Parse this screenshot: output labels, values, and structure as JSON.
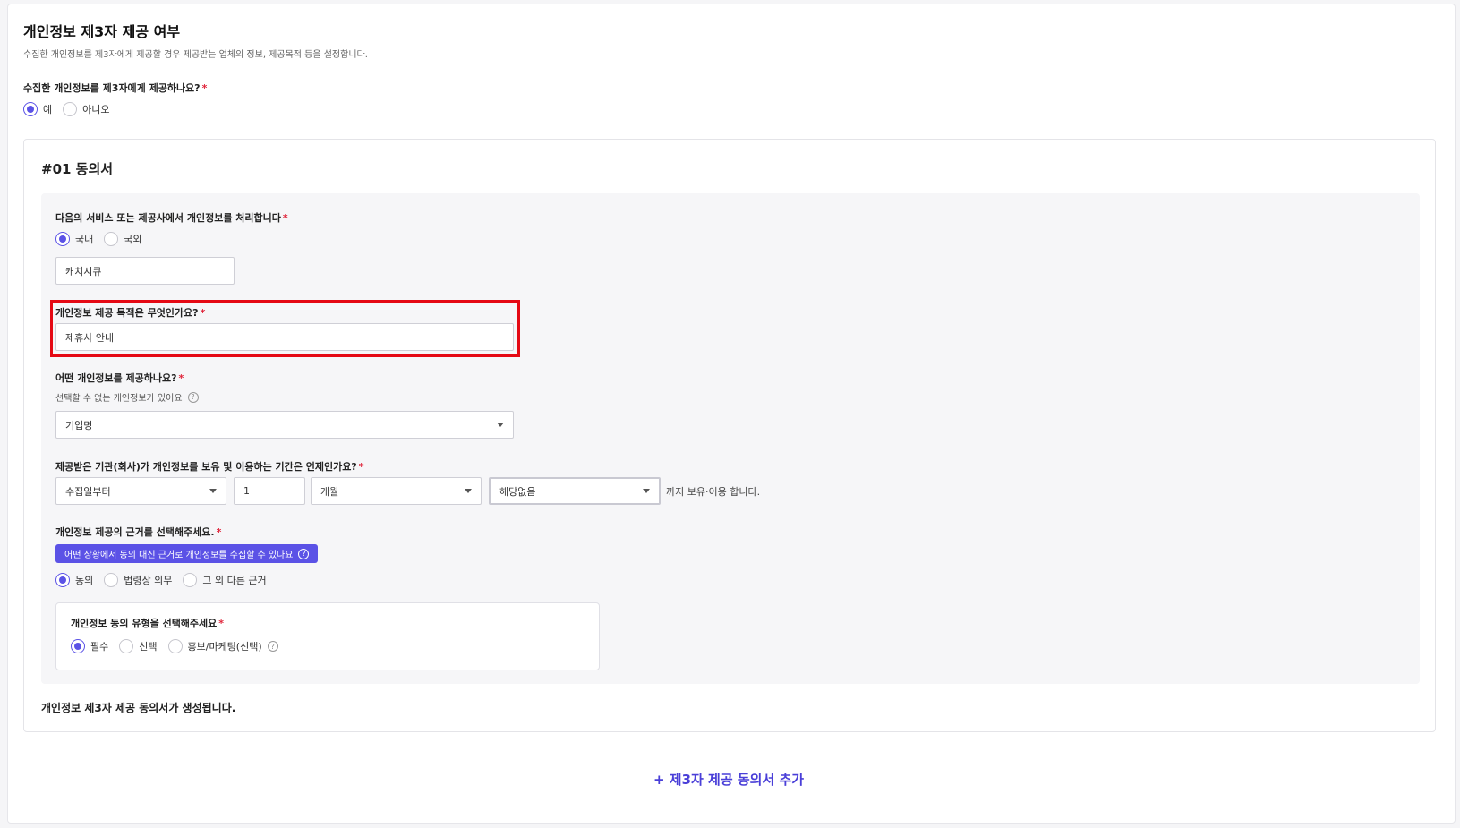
{
  "page": {
    "title": "개인정보 제3자 제공 여부",
    "description": "수집한 개인정보를 제3자에게 제공할 경우 제공받는 업체의 정보, 제공목적 등을 설정합니다."
  },
  "provide_question": {
    "label": "수집한 개인정보를 제3자에게 제공하나요?",
    "required_mark": "*",
    "options": [
      "예",
      "아니오"
    ],
    "selected": "예"
  },
  "consent": {
    "title": "#01 동의서",
    "processor": {
      "label": "다음의 서비스 또는 제공사에서 개인정보를 처리합니다",
      "required_mark": "*",
      "options": [
        "국내",
        "국외"
      ],
      "selected": "국내",
      "company_value": "캐치시큐"
    },
    "purpose": {
      "label": "개인정보 제공 목적은 무엇인가요?",
      "required_mark": "*",
      "value": "제휴사 안내"
    },
    "items": {
      "label": "어떤 개인정보를 제공하나요?",
      "required_mark": "*",
      "hint": "선택할 수 없는 개인정보가 있어요",
      "hint_icon": "?",
      "selected_value": "기업명"
    },
    "period": {
      "label": "제공받은 기관(회사)가 개인정보를 보유 및 이용하는 기간은 언제인가요?",
      "required_mark": "*",
      "start_select": "수집일부터",
      "amount": "1",
      "unit_select": "개월",
      "end_select": "해당없음",
      "suffix": "까지 보유·이용 합니다."
    },
    "basis": {
      "label": "개인정보 제공의 근거를 선택해주세요.",
      "required_mark": "*",
      "info_pill": "어떤 상황에서 동의 대신 근거로 개인정보를 수집할 수 있나요",
      "info_icon": "?",
      "options": [
        "동의",
        "법령상 의무",
        "그 외 다른 근거"
      ],
      "selected": "동의"
    },
    "consent_type": {
      "label": "개인정보 동의 유형을 선택해주세요",
      "required_mark": "*",
      "options": [
        "필수",
        "선택",
        "홍보/마케팅(선택)"
      ],
      "selected": "필수",
      "help_icon": "?"
    },
    "footer_note": "개인정보 제3자 제공 동의서가 생성됩니다."
  },
  "add_button": "+ 제3자 제공 동의서 추가",
  "colors": {
    "accent": "#5b52e6",
    "link": "#4a3fd8",
    "required": "#e0243a",
    "highlight": "#e50914"
  }
}
